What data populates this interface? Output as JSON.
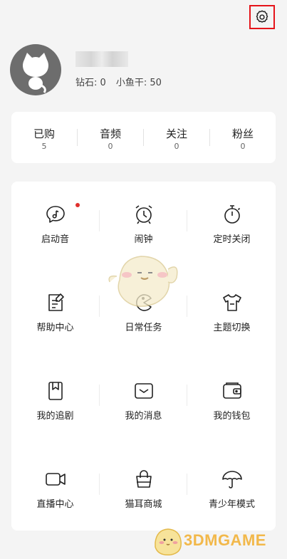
{
  "header": {
    "settings_icon": "gear-icon"
  },
  "profile": {
    "avatar_icon": "cat-avatar",
    "diamond_label": "钻石:",
    "diamond_value": "0",
    "fish_label": "小鱼干:",
    "fish_value": "50"
  },
  "counts": [
    {
      "label": "已购",
      "value": "5"
    },
    {
      "label": "音频",
      "value": "0"
    },
    {
      "label": "关注",
      "value": "0"
    },
    {
      "label": "粉丝",
      "value": "0"
    }
  ],
  "menu": [
    {
      "label": "启动音",
      "icon": "sound-bubble-icon",
      "dot": true
    },
    {
      "label": "闹钟",
      "icon": "alarm-clock-icon"
    },
    {
      "label": "定时关闭",
      "icon": "timer-icon"
    },
    {
      "label": "帮助中心",
      "icon": "help-doc-icon"
    },
    {
      "label": "日常任务",
      "icon": "daily-task-icon"
    },
    {
      "label": "主题切换",
      "icon": "tshirt-icon"
    },
    {
      "label": "我的追剧",
      "icon": "bookmark-icon"
    },
    {
      "label": "我的消息",
      "icon": "message-icon"
    },
    {
      "label": "我的钱包",
      "icon": "wallet-icon"
    },
    {
      "label": "直播中心",
      "icon": "video-camera-icon"
    },
    {
      "label": "猫耳商城",
      "icon": "shopping-bag-icon"
    },
    {
      "label": "青少年模式",
      "icon": "umbrella-icon"
    }
  ],
  "watermark": {
    "text": "3DMGAME"
  },
  "colors": {
    "accent_red": "#e5141a",
    "dot_red": "#e0302d",
    "watermark": "#f2b84a"
  }
}
